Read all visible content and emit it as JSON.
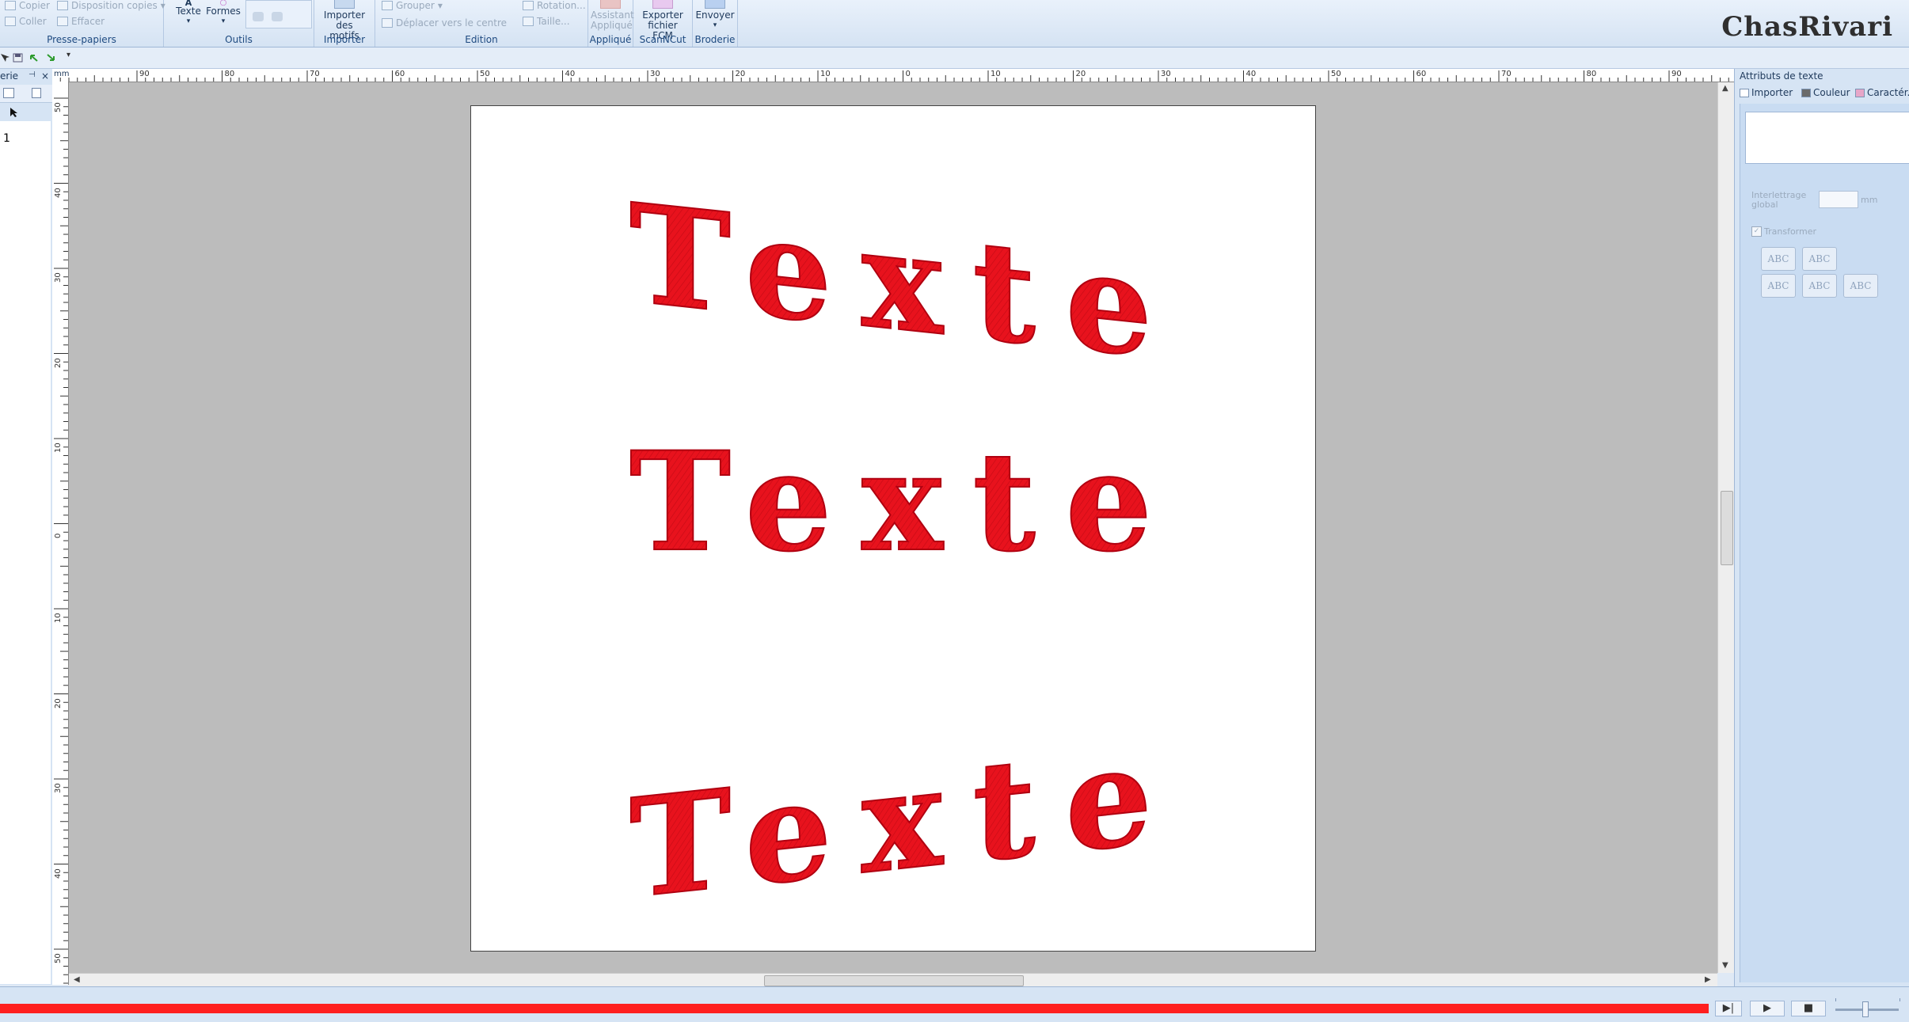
{
  "ribbon": {
    "clipboard": {
      "copy": "Copier",
      "paste": "Coller",
      "layout_copies": "Disposition copies",
      "erase": "Effacer",
      "group_label": "Presse-papiers"
    },
    "tools": {
      "text": "Texte",
      "shapes": "Formes",
      "group_label": "Outils"
    },
    "import": {
      "button": "Importer des motifs",
      "group_label": "Importer"
    },
    "edition": {
      "group": "Grouper",
      "move_center": "Déplacer vers le centre",
      "rotation": "Rotation...",
      "size": "Taille...",
      "group_label": "Edition"
    },
    "applique": {
      "button": "Assistant Appliqué",
      "group_label": "Appliqué"
    },
    "scanncut": {
      "button": "Exporter fichier FCM",
      "group_label": "ScanNCut"
    },
    "embroidery": {
      "button": "Envoyer",
      "group_label": "Broderie"
    }
  },
  "logo": "ChasRivari",
  "left_panel": {
    "title": "erie",
    "items": [
      "1"
    ]
  },
  "canvas": {
    "texts": [
      "Texte",
      "Texte",
      "Texte"
    ],
    "text_color": "#e8121d"
  },
  "ruler": {
    "h_labels": [
      "90",
      "80",
      "70",
      "60",
      "50",
      "40",
      "30",
      "20",
      "10",
      "0",
      "10",
      "20",
      "30",
      "40",
      "50",
      "60",
      "70",
      "80",
      "90"
    ],
    "v_labels": [
      "50",
      "40",
      "30",
      "20",
      "10",
      "0",
      "10",
      "20",
      "30",
      "40",
      "50"
    ]
  },
  "right_panel": {
    "title": "Attributs de texte",
    "tabs": [
      "Importer",
      "Couleur",
      "Caractér..."
    ],
    "spacing_label": "Interlettrage global",
    "spacing_unit": "mm",
    "transform_label": "Transformer",
    "presets": [
      "ABC",
      "ABC",
      "ABC",
      "ABC",
      "ABC"
    ]
  },
  "colors": {
    "ribbon_text": "#1e4a80",
    "progress": "#ff1f1f",
    "canvas_bg": "#bcbcbc"
  }
}
